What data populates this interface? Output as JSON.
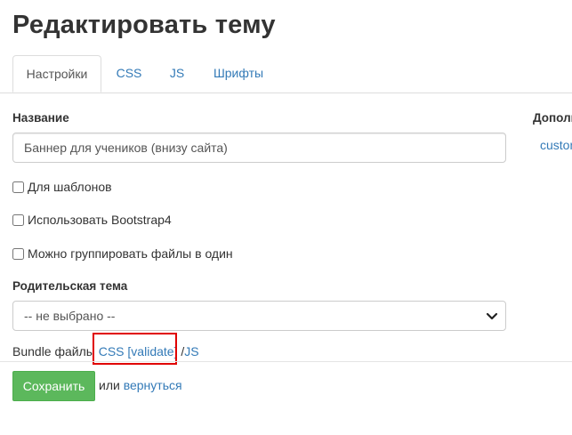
{
  "page": {
    "title": "Редактировать тему"
  },
  "tabs": [
    {
      "label": "Настройки",
      "active": true
    },
    {
      "label": "CSS",
      "active": false
    },
    {
      "label": "JS",
      "active": false
    },
    {
      "label": "Шрифты",
      "active": false
    }
  ],
  "form": {
    "name_label": "Название",
    "name_value": "Баннер для учеников (внизу сайта)",
    "checkboxes": [
      {
        "label": "Для шаблонов",
        "checked": false
      },
      {
        "label": "Использовать Bootstrap4",
        "checked": false
      },
      {
        "label": "Можно группировать файлы в один",
        "checked": false
      }
    ],
    "parent_label": "Родительская тема",
    "parent_selected": "-- не выбрано --",
    "bundle_prefix": "Bundle файлы",
    "bundle_css": "CSS",
    "bundle_validate": "[validate]",
    "bundle_sep": "/",
    "bundle_js": "JS"
  },
  "actions": {
    "save_label": "Сохранить",
    "or_text": "или",
    "back_link": "вернуться"
  },
  "sidebar": {
    "heading": "Дополн",
    "link": "custom"
  },
  "colors": {
    "accent_link": "#337ab7",
    "save_green": "#5cb85c",
    "highlight_red": "#e00000"
  }
}
